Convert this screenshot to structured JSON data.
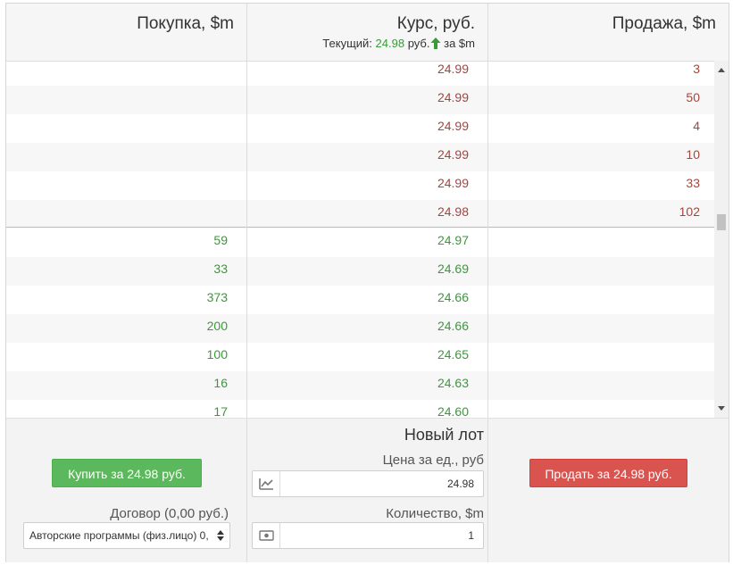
{
  "header": {
    "buy_title": "Покупка, $m",
    "rate_title": "Курс, руб.",
    "rate_current_prefix": "Текущий:",
    "rate_current_value": "24.98",
    "rate_current_unit": "руб.",
    "rate_current_suffix": "за $m",
    "sell_title": "Продажа, $m"
  },
  "sell_orders": [
    {
      "rate": "24.99",
      "amount": "3"
    },
    {
      "rate": "24.99",
      "amount": "50"
    },
    {
      "rate": "24.99",
      "amount": "4"
    },
    {
      "rate": "24.99",
      "amount": "10"
    },
    {
      "rate": "24.99",
      "amount": "33"
    },
    {
      "rate": "24.98",
      "amount": "102"
    }
  ],
  "buy_orders": [
    {
      "amount": "59",
      "rate": "24.97"
    },
    {
      "amount": "33",
      "rate": "24.69"
    },
    {
      "amount": "373",
      "rate": "24.66"
    },
    {
      "amount": "200",
      "rate": "24.66"
    },
    {
      "amount": "100",
      "rate": "24.65"
    },
    {
      "amount": "16",
      "rate": "24.63"
    },
    {
      "amount": "17",
      "rate": "24.60"
    }
  ],
  "colors": {
    "sell": "#a8443a",
    "buy": "#3a9a3a",
    "buy_button": "#5cb85c",
    "sell_button": "#d9534f"
  },
  "bottom": {
    "buy_button": "Купить за 24.98 руб.",
    "contract_label": "Договор (0,00 руб.)",
    "contract_value": "Авторские программы (физ.лицо) 0,",
    "new_lot": "Новый лот",
    "price_label": "Цена за ед., руб",
    "price_value": "24.98",
    "price_icon": "chart-icon",
    "qty_label": "Количество, $m",
    "qty_value": "1",
    "qty_icon": "money-icon",
    "sell_button": "Продать за 24.98 руб."
  }
}
